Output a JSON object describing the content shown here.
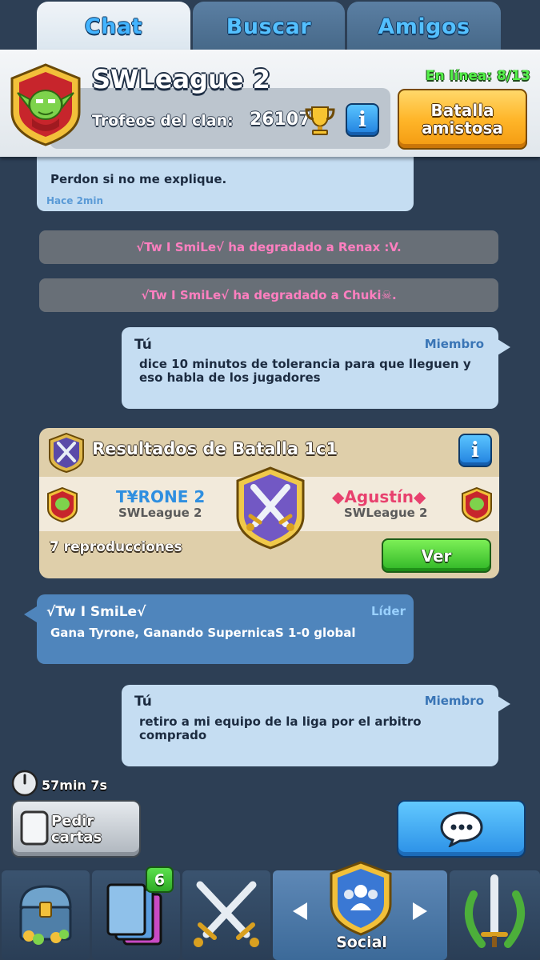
{
  "tabs": [
    {
      "label": "Chat",
      "active": true
    },
    {
      "label": "Buscar",
      "active": false
    },
    {
      "label": "Amigos",
      "active": false
    }
  ],
  "clan": {
    "name": "SWLeague 2",
    "trophies_label": "Trofeos del clan:",
    "trophies": "26107",
    "online": "En línea: 8/13",
    "info_icon": "i",
    "friendly_battle_label": "Batalla\namistosa"
  },
  "chat": [
    {
      "type": "partial",
      "text": "Perdon si no me explique.",
      "time": "Hace 2min"
    },
    {
      "type": "system",
      "text": "√Tw I SmiLe√ ha degradado a Renax :V."
    },
    {
      "type": "system",
      "text": "√Tw I SmiLe√ ha degradado a Chuki☠."
    },
    {
      "type": "own",
      "sender": "Tú",
      "role": "Miembro",
      "text": "dice 10 minutos de tolerancia para que lleguen y eso habla de los jugadores"
    },
    {
      "type": "other",
      "sender": "√Tw I SmiLe√",
      "role": "Líder",
      "text": "Gana Tyrone, Ganando SupernicaS 1-0 global"
    },
    {
      "type": "own",
      "sender": "Tú",
      "role": "Miembro",
      "text": "retiro a mi equipo de la liga por el arbitro comprado"
    }
  ],
  "battle": {
    "title": "Resultados de Batalla 1c1",
    "player1": {
      "name": "T¥RONE 2",
      "clan": "SWLeague 2"
    },
    "player2": {
      "name": "◆Agustín◆",
      "clan": "SWLeague 2"
    },
    "views": "7 reproducciones",
    "view_button": "Ver"
  },
  "footer": {
    "timer": "57min 7s",
    "request_label": "Pedir\ncartas"
  },
  "nav": {
    "items": [
      {
        "name": "chest",
        "icon": "treasure-chest-icon"
      },
      {
        "name": "cards",
        "icon": "cards-icon",
        "badge": "6"
      },
      {
        "name": "battle",
        "icon": "crossed-swords-icon"
      },
      {
        "name": "social",
        "icon": "social-shield-icon",
        "label": "Social",
        "active": true
      },
      {
        "name": "tournaments",
        "icon": "sword-laurel-icon"
      }
    ]
  },
  "colors": {
    "background": "#2d3f55",
    "system_text": "#ff7fc0",
    "online_green": "#54f04a",
    "tab_blue": "#43b4ff"
  }
}
